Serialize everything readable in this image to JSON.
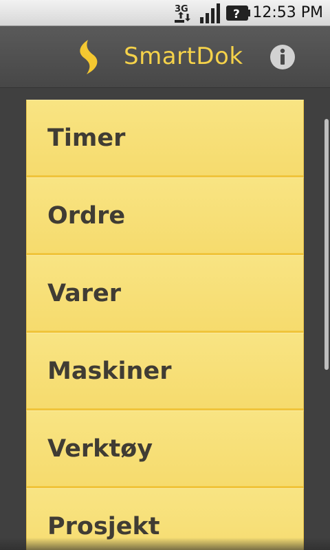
{
  "status_bar": {
    "network_icon": "3g-data-icon",
    "signal_icon": "signal-strength-icon",
    "battery_icon": "battery-unknown-icon",
    "network_label": "3G",
    "time": "12:53 PM"
  },
  "title_bar": {
    "logo_icon": "smartdok-logo-icon",
    "title": "SmartDok",
    "info_icon": "info-icon"
  },
  "menu": {
    "items": [
      {
        "label": "Timer"
      },
      {
        "label": "Ordre"
      },
      {
        "label": "Varer"
      },
      {
        "label": "Maskiner"
      },
      {
        "label": "Verktøy"
      },
      {
        "label": "Prosjekt"
      }
    ]
  },
  "colors": {
    "accent": "#f5d24a",
    "menu_item_background": "#f7df78",
    "menu_item_border": "#f0c43a",
    "menu_text": "#403c34",
    "background": "#404040"
  }
}
